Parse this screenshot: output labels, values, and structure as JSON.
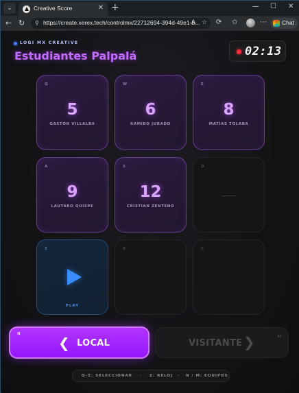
{
  "browser": {
    "tab_title": "Creative Score",
    "url": "https://create.xerex.tech/controlmx/22712694-394d-49e1-b...",
    "chat_label": "Chat",
    "new_tab": "+",
    "window_controls": [
      "—",
      "☐",
      "✕"
    ]
  },
  "app": {
    "brand": "LOGI MX CREATIVE",
    "team_name": "Estudiantes Palpalá",
    "timer": "02:13",
    "timer_status_color": "#ff2b3b",
    "accent_color": "#a020ff"
  },
  "grid": [
    {
      "key": "Q",
      "number": "5",
      "player": "GASTÓN VILLALBA",
      "state": "filled"
    },
    {
      "key": "W",
      "number": "6",
      "player": "RAMIRO JURADO",
      "state": "filled"
    },
    {
      "key": "E",
      "number": "8",
      "player": "MATÍAS TOLABA",
      "state": "filled"
    },
    {
      "key": "A",
      "number": "9",
      "player": "LAUTARO QUISPE",
      "state": "filled"
    },
    {
      "key": "S",
      "number": "12",
      "player": "CRISTIAN ZENTENO",
      "state": "filled"
    },
    {
      "key": "D",
      "number": "",
      "player": "",
      "state": "empty-dash"
    },
    {
      "key": "Z",
      "label": "PLAY",
      "state": "play"
    },
    {
      "key": "X",
      "state": "empty"
    },
    {
      "key": "C",
      "state": "empty"
    }
  ],
  "buttons": {
    "local": {
      "key": "N",
      "label": "LOCAL",
      "icon": "chevron-left-icon"
    },
    "visitante": {
      "key": "M",
      "label": "VISITANTE",
      "icon": "chevron-right-icon"
    }
  },
  "hints": {
    "select": "Q-S: SELECCIONAR",
    "clock": "Z: RELOJ",
    "teams": "N / M: EQUIPOS",
    "separator": "·"
  }
}
